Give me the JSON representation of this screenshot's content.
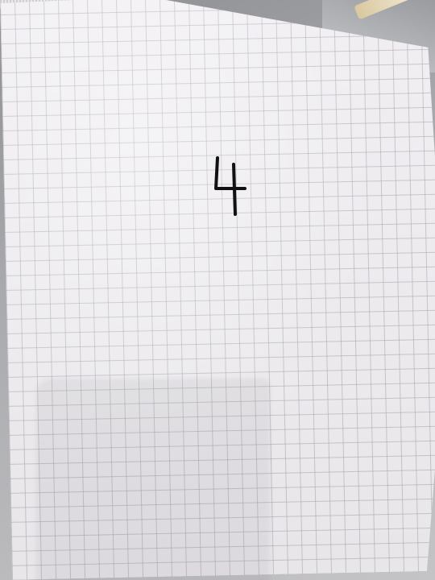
{
  "scene": {
    "subject": "graph-paper-sheet",
    "handwritten_text": "4",
    "colors": {
      "paper": "#f1eff2",
      "grid": "#aaa5b4",
      "ink": "#111111",
      "background": "#b8b8ba"
    }
  }
}
